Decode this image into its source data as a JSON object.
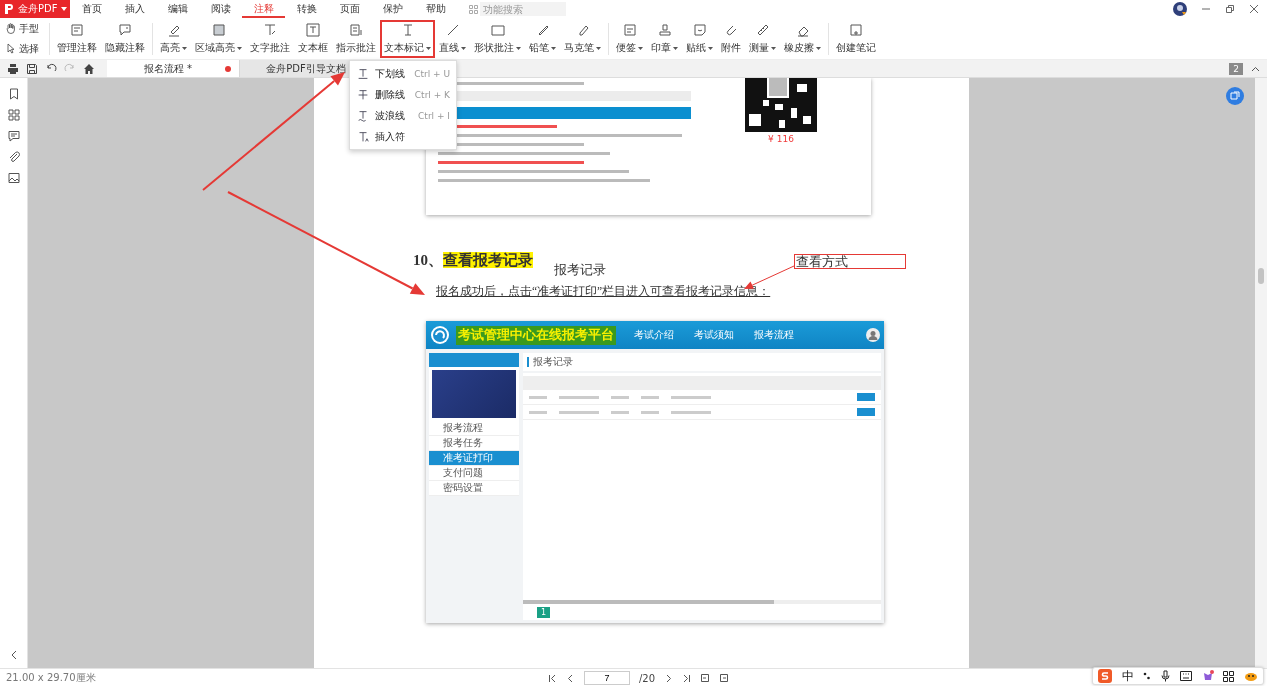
{
  "app": {
    "name": "金舟PDF"
  },
  "menu_tabs": [
    {
      "label": "首页",
      "selected": false
    },
    {
      "label": "插入",
      "selected": false
    },
    {
      "label": "编辑",
      "selected": false
    },
    {
      "label": "阅读",
      "selected": false
    },
    {
      "label": "注释",
      "selected": true
    },
    {
      "label": "转换",
      "selected": false
    },
    {
      "label": "页面",
      "selected": false
    },
    {
      "label": "保护",
      "selected": false
    },
    {
      "label": "帮助",
      "selected": false
    }
  ],
  "search": {
    "placeholder": "功能搜索"
  },
  "pointer_tools": [
    {
      "label": "手型"
    },
    {
      "label": "选择"
    }
  ],
  "tool_groups": [
    {
      "tools": [
        {
          "label": "管理注释",
          "menu": false,
          "selected": false
        },
        {
          "label": "隐藏注释",
          "menu": false,
          "selected": false
        }
      ]
    },
    {
      "tools": [
        {
          "label": "高亮",
          "menu": true,
          "selected": false
        },
        {
          "label": "区域高亮",
          "menu": true,
          "selected": false
        },
        {
          "label": "文字批注",
          "menu": false,
          "selected": false
        },
        {
          "label": "文本框",
          "menu": false,
          "selected": false
        },
        {
          "label": "指示批注",
          "menu": false,
          "selected": false
        },
        {
          "label": "文本标记",
          "menu": true,
          "selected": true
        },
        {
          "label": "直线",
          "menu": true,
          "selected": false
        },
        {
          "label": "形状批注",
          "menu": true,
          "selected": false
        },
        {
          "label": "铅笔",
          "menu": true,
          "selected": false
        },
        {
          "label": "马克笔",
          "menu": true,
          "selected": false
        }
      ]
    },
    {
      "tools": [
        {
          "label": "便签",
          "menu": true,
          "selected": false
        },
        {
          "label": "印章",
          "menu": true,
          "selected": false
        },
        {
          "label": "贴纸",
          "menu": true,
          "selected": false
        },
        {
          "label": "附件",
          "menu": false,
          "selected": false
        },
        {
          "label": "测量",
          "menu": true,
          "selected": false
        },
        {
          "label": "橡皮擦",
          "menu": true,
          "selected": false
        }
      ]
    },
    {
      "tools": [
        {
          "label": "创建笔记",
          "menu": false,
          "selected": false
        }
      ]
    }
  ],
  "doc_tabs": [
    {
      "label": "报名流程 *",
      "selected": true,
      "unsaved": true
    },
    {
      "label": "金舟PDF引导文档",
      "selected": false,
      "unsaved": false
    }
  ],
  "page_badge": "2",
  "text_markup_menu": [
    {
      "label": "下划线",
      "shortcut": "Ctrl + U"
    },
    {
      "label": "删除线",
      "shortcut": "Ctrl + K"
    },
    {
      "label": "波浪线",
      "shortcut": "Ctrl + I"
    },
    {
      "label": "插入符"
    }
  ],
  "document": {
    "top_image": {
      "price": "¥ 116"
    },
    "heading": {
      "number": "10、",
      "title": "查看报考记录",
      "highlighted": true
    },
    "paragraph": {
      "text": "报名成功后，点击“准考证打印”栏目进入可查看报考记录信息：",
      "underlined": true
    },
    "free_text": "报考记录",
    "callout": "查看方式",
    "screenshot": {
      "title": "考试管理中心在线报考平台",
      "nav": [
        "考试介绍",
        "考试须知",
        "报考流程"
      ],
      "records_title": "报考记录",
      "menu": [
        {
          "label": "报考流程",
          "selected": false
        },
        {
          "label": "报考任务",
          "selected": false
        },
        {
          "label": "准考证打印",
          "selected": true
        },
        {
          "label": "支付问题",
          "selected": false
        },
        {
          "label": "密码设置",
          "selected": false
        }
      ],
      "current_page": "1"
    }
  },
  "status_bar": {
    "page_size": "21.00 x 29.70厘米",
    "page": "7",
    "total": "/20"
  },
  "ime": {
    "mode": "中"
  }
}
